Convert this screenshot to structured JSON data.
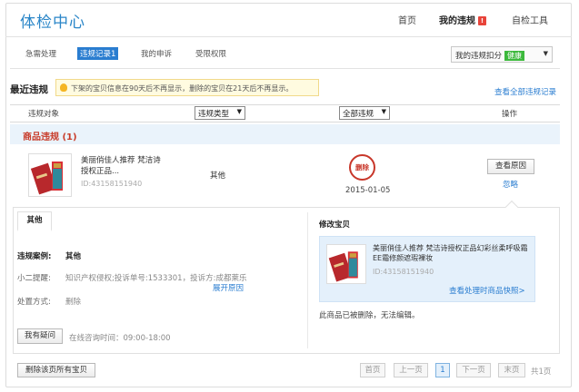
{
  "header": {
    "title": "体检中心",
    "nav": [
      "首页",
      "我的违规",
      "自检工具"
    ],
    "violation_badge": "!"
  },
  "tabs": [
    "急需处理",
    "违规记录1",
    "我的申诉",
    "受限权限"
  ],
  "score": {
    "label": "我的违规扣分",
    "status": "健康"
  },
  "recent": {
    "title": "最近违规",
    "notice": "下架的宝贝信息在90天后不再显示，删除的宝贝在21天后不再显示。",
    "view_all": "查看全部违规记录"
  },
  "table": {
    "col_object": "违规对象",
    "type_select": "违规类型",
    "all_select": "全部违规",
    "col_action": "操作"
  },
  "section": {
    "title": "商品违规 (1)"
  },
  "item": {
    "name": "美丽俏佳人推荐 梵洁诗授权正品...",
    "id": "ID:43158151940",
    "type": "其他",
    "stamp": "删除",
    "date": "2015-01-05",
    "view_reason": "查看原因",
    "ignore": "忽略"
  },
  "detail": {
    "tab": "其他",
    "case_label": "违规案例:",
    "case_value": "其他",
    "hint_label": "小二提醒:",
    "hint_value": "知识产权侵权;投诉单号:1533301，投诉方:成都萊乐",
    "expand": "展开原因",
    "method_label": "处置方式:",
    "method_value": "删除",
    "question_btn": "我有疑问",
    "online_time": "在线咨询时间：09:00-18:00",
    "modify_title": "修改宝贝",
    "modify_name": "美丽俏佳人推荐 梵洁诗授权正品幻彩丝柔呼吸霜EE霜修颜遮瑕裸妆",
    "modify_id": "ID:43158151940",
    "snapshot_link": "查看处理时商品快照>",
    "deleted_note": "此商品已被删除，无法编辑。"
  },
  "footer": {
    "delete_all": "删除该页所有宝贝",
    "first": "首页",
    "prev": "上一页",
    "page": "1",
    "next": "下一页",
    "last": "末页",
    "total": "共1页"
  }
}
